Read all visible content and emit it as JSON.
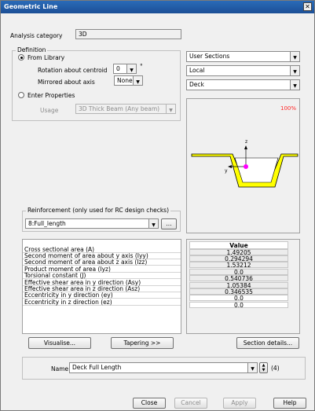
{
  "window": {
    "title": "Geometric Line"
  },
  "analysis": {
    "label": "Analysis category",
    "value": "3D"
  },
  "definition": {
    "group_label": "Definition",
    "from_library_label": "From Library",
    "rotation_label": "Rotation about centroid",
    "rotation_value": "0",
    "rotation_unit": "°",
    "mirrored_label": "Mirrored about axis",
    "mirrored_value": "None",
    "enter_properties_label": "Enter Properties",
    "usage_label": "Usage",
    "usage_value": "3D Thick Beam (Any beam)"
  },
  "library": {
    "category": "User Sections",
    "location": "Local",
    "section": "Deck"
  },
  "preview": {
    "zoom": "100%",
    "axis_z": "z",
    "axis_y": "y",
    "section_color": "#ffff00",
    "centroid_color": "#ff00ff"
  },
  "reinforcement": {
    "group_label": "Reinforcement (only used for RC design checks)",
    "value": "8:Full_length",
    "browse_label": "..."
  },
  "properties": {
    "value_header": "Value",
    "rows": [
      {
        "label": "Cross sectional area (A)",
        "value": "1.49205"
      },
      {
        "label": "Second moment of area about y axis (Iyy)",
        "value": "0.294294"
      },
      {
        "label": "Second moment of area about z axis (Izz)",
        "value": "1.53212"
      },
      {
        "label": "Product moment of area (Iyz)",
        "value": "0.0"
      },
      {
        "label": "Torsional constant (J)",
        "value": "0.540736"
      },
      {
        "label": "Effective shear area in y direction (Asy)",
        "value": "1.05384"
      },
      {
        "label": "Effective shear area in z direction (Asz)",
        "value": "0.346535"
      },
      {
        "label": "Eccentricity in y direction (ey)",
        "value": "0.0"
      },
      {
        "label": "Eccentricity in z direction (ez)",
        "value": "0.0"
      }
    ]
  },
  "buttons": {
    "visualise": "Visualise...",
    "tapering": "Tapering >>",
    "section_details": "Section details...",
    "close": "Close",
    "cancel": "Cancel",
    "apply": "Apply",
    "help": "Help"
  },
  "name": {
    "label": "Name",
    "value": "Deck Full Length",
    "count": "(4)"
  }
}
